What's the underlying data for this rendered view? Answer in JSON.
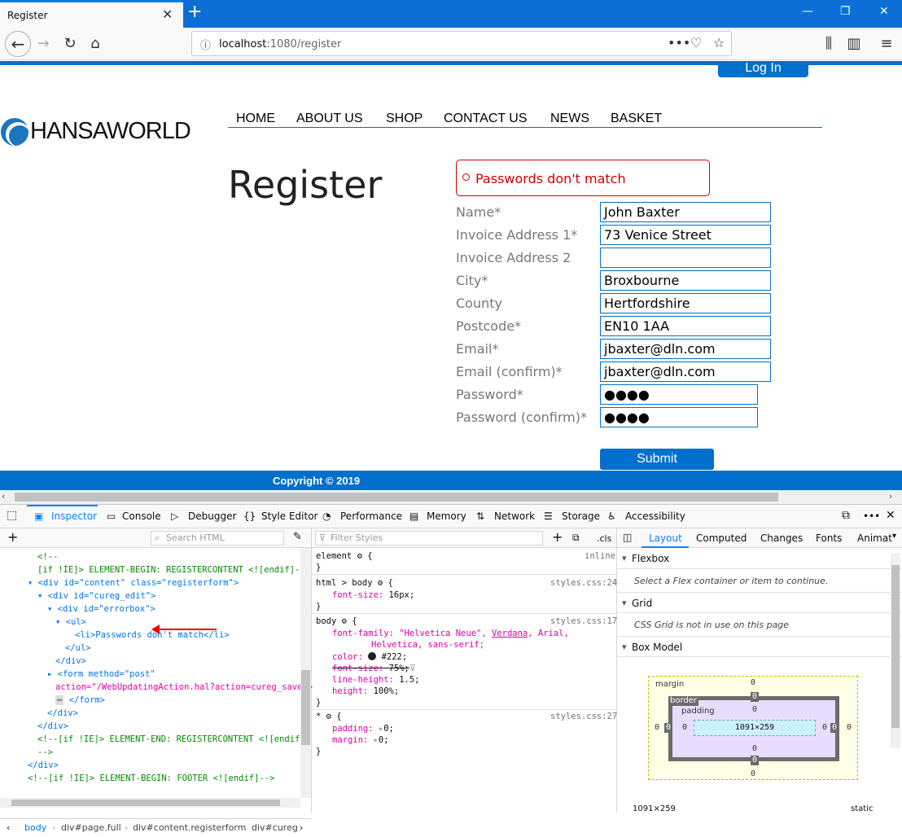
{
  "browser": {
    "tab_title": "Register",
    "url_host": "localhost",
    "url_path": ":1080/register",
    "new_tab_symbol": "+"
  },
  "site": {
    "login_label": "Log In",
    "logo_text": "HANSAWORLD",
    "nav": [
      "HOME",
      "ABOUT US",
      "SHOP",
      "CONTACT US",
      "NEWS",
      "BASKET"
    ],
    "page_title": "Register",
    "error_message": "Passwords don't match",
    "form": [
      {
        "label": "Name*",
        "value": "John Baxter"
      },
      {
        "label": "Invoice Address 1*",
        "value": "73 Venice Street"
      },
      {
        "label": "Invoice Address 2",
        "value": ""
      },
      {
        "label": "City*",
        "value": "Broxbourne"
      },
      {
        "label": "County",
        "value": "Hertfordshire"
      },
      {
        "label": "Postcode*",
        "value": "EN10 1AA"
      },
      {
        "label": "Email*",
        "value": "jbaxter@dln.com"
      },
      {
        "label": "Email (confirm)*",
        "value": "jbaxter@dln.com"
      },
      {
        "label": "Password*",
        "value": "●●●●"
      },
      {
        "label": "Password (confirm)*",
        "value": "●●●●"
      }
    ],
    "submit_label": "Submit",
    "footer": "Copyright © 2019"
  },
  "devtools": {
    "tabs": [
      "Inspector",
      "Console",
      "Debugger",
      "Style Editor",
      "Performance",
      "Memory",
      "Network",
      "Storage",
      "Accessibility"
    ],
    "search_html_placeholder": "Search HTML",
    "filter_styles_placeholder": "Filter Styles",
    "cls_label": ".cls",
    "markup": [
      "<!--",
      "[if !IE]> ELEMENT-BEGIN: REGISTERCONTENT <![endif]-->",
      "<div id=\"content\" class=\"registerform\">",
      "<div id=\"cureg_edit\">",
      "<div id=\"errorbox\">",
      "<ul>",
      "<li>Passwords don't match</li>",
      "</ul>",
      "</div>",
      "<form method=\"post\"",
      "action=\"/WebUpdatingAction.hal?action=cureg_save\">",
      "</form>",
      "</div>",
      "</div>",
      "<!--[if !IE]> ELEMENT-END: REGISTERCONTENT <![endif]",
      "-->",
      "</div>",
      "<!--[if !IE]> ELEMENT-BEGIN: FOOTER <![endif]-->"
    ],
    "rules": {
      "element_sel": "element",
      "element_src": "inline",
      "html_body_sel": "html > body",
      "html_body_src": "styles.css:24",
      "html_body_prop": "font-size:",
      "html_body_val": "16px;",
      "body_sel": "body",
      "body_src": "styles.css:17",
      "ff_prop": "font-family:",
      "ff_val_1": "\"Helvetica Neue\",",
      "ff_val_2": "Verdana",
      "ff_val_3": ", Arial,",
      "ff_val_4": "Helvetica, sans-serif;",
      "color_prop": "color:",
      "color_val": "#222;",
      "fs_prop": "font-size:",
      "fs_val": "75%;",
      "lh_prop": "line-height:",
      "lh_val": "1.5;",
      "h_prop": "height:",
      "h_val": "100%;",
      "star_sel": "*",
      "star_src": "styles.css:27",
      "pad_prop": "padding:",
      "pad_val": "0;",
      "mar_prop": "margin:",
      "mar_val": "0;",
      "open_brace": "{",
      "close_brace": "}"
    },
    "layout_tabs": [
      "Layout",
      "Computed",
      "Changes",
      "Fonts",
      "Animat"
    ],
    "flexbox_title": "Flexbox",
    "flexbox_msg": "Select a Flex container or item to continue.",
    "grid_title": "Grid",
    "grid_msg": "CSS Grid is not in use on this page",
    "boxmodel_title": "Box Model",
    "bm_margin": "margin",
    "bm_border": "border",
    "bm_padding": "padding",
    "bm_size": "1091×259",
    "bm_zero": "0",
    "bm_footer_size": "1091×259",
    "bm_footer_pos": "static",
    "breadcrumbs": [
      "body",
      "div#page.full",
      "div#content.registerform",
      "div#cureg"
    ]
  }
}
